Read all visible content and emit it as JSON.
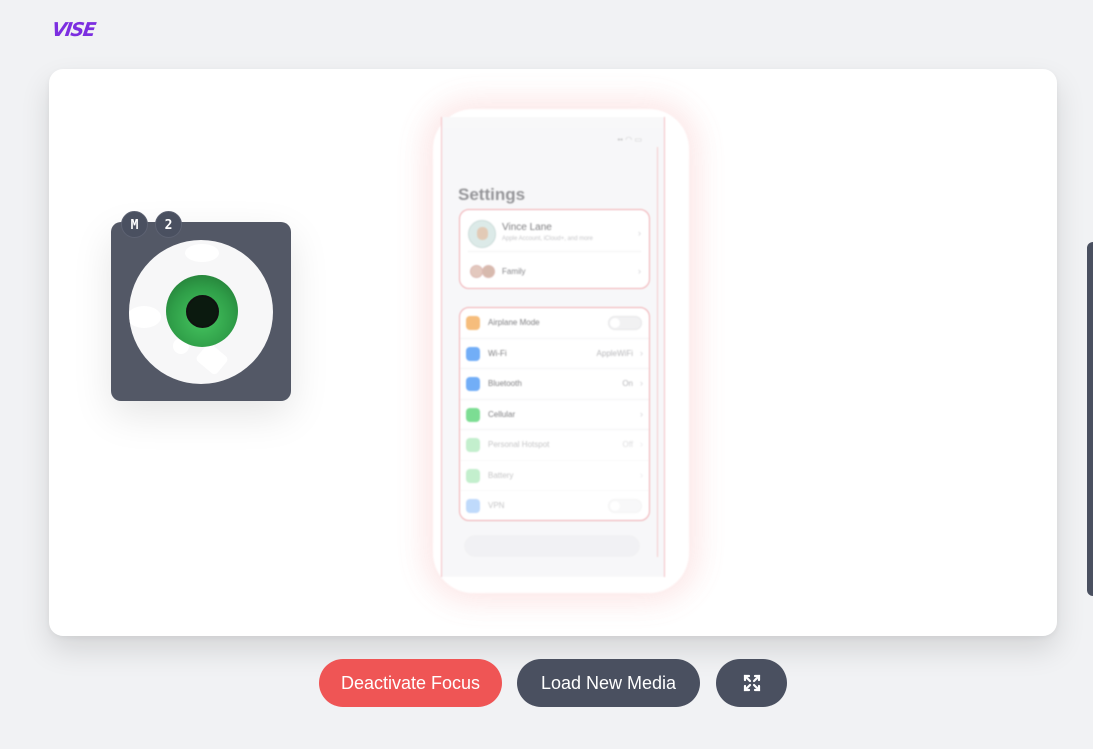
{
  "app": {
    "logo_text": "VISE",
    "brand_color": "#7c2ee0"
  },
  "focus_widget": {
    "badge_mode": "M",
    "badge_count": "2",
    "icon": "eye-icon",
    "iris_color": "#3caf55"
  },
  "phone": {
    "title": "Settings",
    "account": {
      "name": "Vince Lane",
      "subtitle": "Apple Account, iCloud+, and more",
      "family_label": "Family"
    },
    "rows": [
      {
        "label": "Airplane Mode",
        "value": "",
        "icon_color": "#f3a54a",
        "control": "toggle"
      },
      {
        "label": "Wi-Fi",
        "value": "AppleWiFi",
        "icon_color": "#3d8ff5",
        "control": "chevron"
      },
      {
        "label": "Bluetooth",
        "value": "On",
        "icon_color": "#3d8ff5",
        "control": "chevron"
      },
      {
        "label": "Cellular",
        "value": "",
        "icon_color": "#4bd06a",
        "control": "chevron"
      },
      {
        "label": "Personal Hotspot",
        "value": "Off",
        "icon_color": "#4bd06a",
        "control": "chevron"
      },
      {
        "label": "Battery",
        "value": "",
        "icon_color": "#4bd06a",
        "control": "chevron"
      },
      {
        "label": "VPN",
        "value": "",
        "icon_color": "#3d8ff5",
        "control": "toggle"
      }
    ]
  },
  "controls": {
    "deactivate_label": "Deactivate Focus",
    "load_label": "Load New Media",
    "fullscreen_icon": "expand-icon",
    "accent_red": "#ef5555",
    "dark": "#4a5060"
  }
}
